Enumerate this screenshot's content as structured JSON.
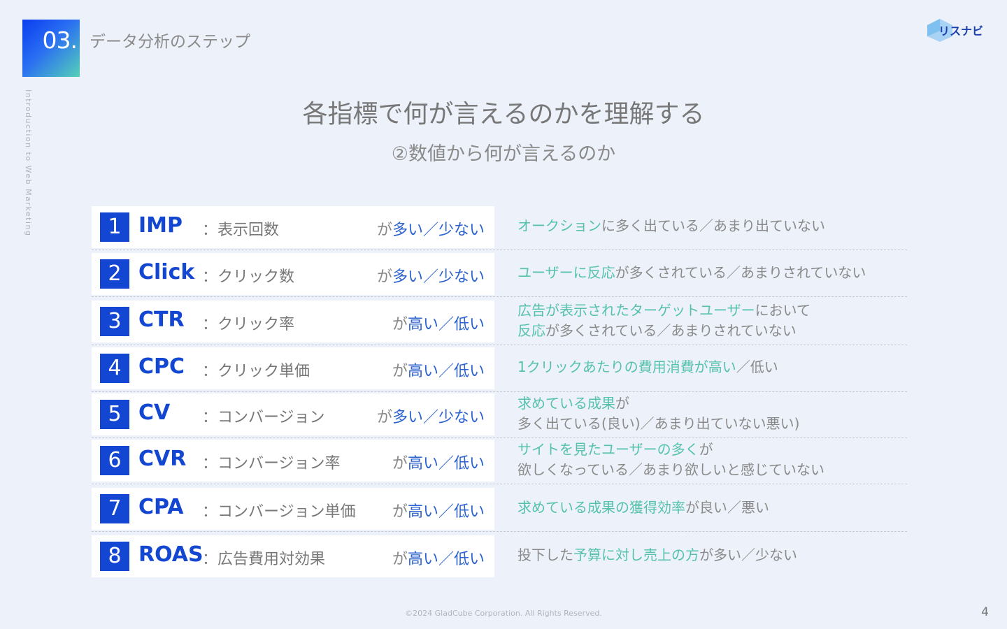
{
  "section": {
    "number": "03.",
    "title": "データ分析のステップ"
  },
  "side_label": "Introduction to Web Marketing",
  "logo": {
    "text": "リスナビ"
  },
  "main_title": "各指標で何が言えるのかを理解する",
  "sub_title": "②数値から何が言えるのか",
  "rows": [
    {
      "num": "1",
      "metric": "IMP",
      "desc": "：表示回数",
      "ga": "が",
      "eval": "多い／少ない",
      "meaning": [
        [
          {
            "t": "オークション",
            "hl": true
          },
          {
            "t": "に多く出ている／あまり出ていない",
            "hl": false
          }
        ]
      ]
    },
    {
      "num": "2",
      "metric": "Click",
      "desc": "：クリック数",
      "ga": "が",
      "eval": "多い／少ない",
      "meaning": [
        [
          {
            "t": "ユーザーに反応",
            "hl": true
          },
          {
            "t": "が多くされている／あまりされていない",
            "hl": false
          }
        ]
      ]
    },
    {
      "num": "3",
      "metric": "CTR",
      "desc": "：クリック率",
      "ga": "が",
      "eval": "高い／低い",
      "meaning": [
        [
          {
            "t": "広告が表示されたターゲットユーザー",
            "hl": true
          },
          {
            "t": "において",
            "hl": false
          }
        ],
        [
          {
            "t": "反応",
            "hl": true
          },
          {
            "t": "が多くされている／あまりされていない",
            "hl": false
          }
        ]
      ]
    },
    {
      "num": "4",
      "metric": "CPC",
      "desc": "：クリック単価",
      "ga": "が",
      "eval": "高い／低い",
      "meaning": [
        [
          {
            "t": "1クリックあたりの費用消費が高い",
            "hl": true
          },
          {
            "t": "／低い",
            "hl": false
          }
        ]
      ]
    },
    {
      "num": "5",
      "metric": "CV",
      "desc": "：コンバージョン",
      "ga": "が",
      "eval": "多い／少ない",
      "meaning": [
        [
          {
            "t": "求めている成果",
            "hl": true
          },
          {
            "t": "が",
            "hl": false
          }
        ],
        [
          {
            "t": "多く出ている(良い)／あまり出ていない悪い)",
            "hl": false
          }
        ]
      ]
    },
    {
      "num": "6",
      "metric": "CVR",
      "desc": "：コンバージョン率",
      "ga": "が",
      "eval": "高い／低い",
      "meaning": [
        [
          {
            "t": "サイトを見たユーザーの多く",
            "hl": true
          },
          {
            "t": "が",
            "hl": false
          }
        ],
        [
          {
            "t": "欲しくなっている／あまり欲しいと感じていない",
            "hl": false
          }
        ]
      ]
    },
    {
      "num": "7",
      "metric": "CPA",
      "desc": "：コンバージョン単価",
      "ga": "が",
      "eval": "高い／低い",
      "meaning": [
        [
          {
            "t": "求めている成果の獲得効率",
            "hl": true
          },
          {
            "t": "が良い／悪い",
            "hl": false
          }
        ]
      ]
    },
    {
      "num": "8",
      "metric": "ROAS",
      "desc": "：広告費用対効果",
      "ga": "が",
      "eval": "高い／低い",
      "meaning": [
        [
          {
            "t": "投下した",
            "hl": false
          },
          {
            "t": "予算に対し売上の方",
            "hl": true
          },
          {
            "t": "が多い／少ない",
            "hl": false
          }
        ]
      ]
    }
  ],
  "footer": "©2024 GladCube Corporation. All Rights Reserved.",
  "page_number": "4",
  "colors": {
    "accent_blue": "#1446d4",
    "accent_teal": "#55c1ad",
    "background": "#edf2fa"
  }
}
